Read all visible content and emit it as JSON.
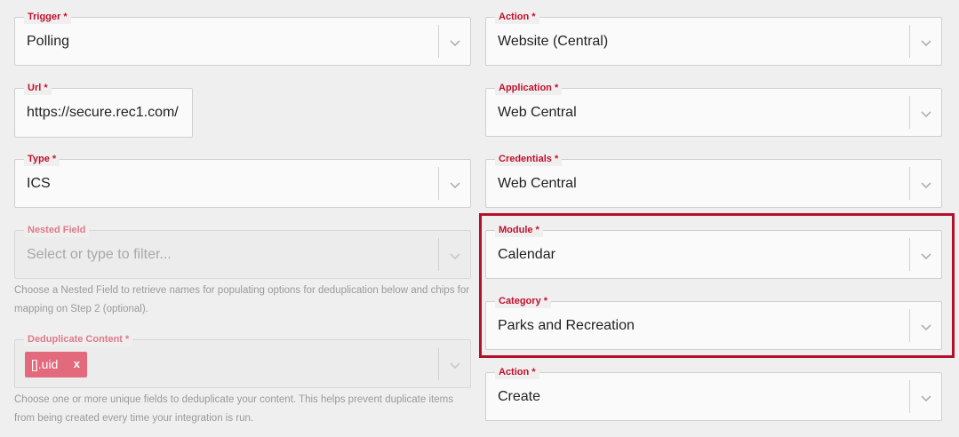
{
  "left": {
    "trigger": {
      "label": "Trigger *",
      "value": "Polling"
    },
    "url": {
      "label": "Url *",
      "value": "https://secure.rec1.com/"
    },
    "type": {
      "label": "Type *",
      "value": "ICS"
    },
    "nested_field": {
      "label": "Nested Field",
      "placeholder": "Select or type to filter...",
      "helper": "Choose a Nested Field to retrieve names for populating options for deduplication below and chips for mapping on Step 2 (optional)."
    },
    "deduplicate": {
      "label": "Deduplicate Content *",
      "chip": {
        "label": "[].uid",
        "remove": "x"
      },
      "helper": "Choose one or more unique fields to deduplicate your content. This helps prevent duplicate items from being created every time your integration is run."
    }
  },
  "right": {
    "action_top": {
      "label": "Action *",
      "value": "Website (Central)"
    },
    "application": {
      "label": "Application *",
      "value": "Web Central"
    },
    "credentials": {
      "label": "Credentials *",
      "value": "Web Central"
    },
    "module": {
      "label": "Module *",
      "value": "Calendar"
    },
    "category": {
      "label": "Category *",
      "value": "Parks and Recreation"
    },
    "action_bottom": {
      "label": "Action *",
      "value": "Create"
    }
  },
  "icons": {
    "dropdown": "chevron-down-icon"
  },
  "colors": {
    "label_required": "#c0102c",
    "highlight_border": "#b5102a",
    "chip_bg": "#e26a7c"
  }
}
